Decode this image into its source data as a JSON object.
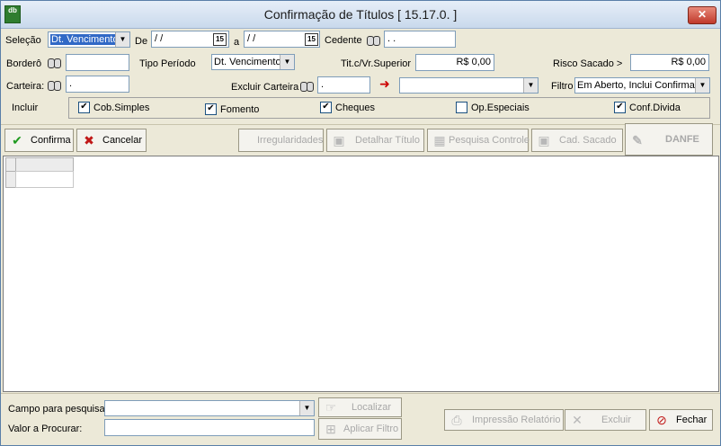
{
  "window": {
    "title": "Confirmação de Títulos [ 15.17.0. ]",
    "app_icon_text": "db",
    "close_glyph": "✕"
  },
  "filters": {
    "selecao_label": "Seleção",
    "selecao_value": "Dt. Vencimento",
    "de_label": "De",
    "de_value": " / /",
    "a_label": "a",
    "a_value": " / /",
    "calendar_glyph": "15",
    "cedente_label": "Cedente",
    "cedente_value": "  .  .",
    "bordero_label": "Borderô",
    "bordero_value": "",
    "tipo_periodo_label": "Tipo Período",
    "tipo_periodo_value": "Dt. Vencimento",
    "tit_vr_superior_label": "Tit.c/Vr.Superior",
    "tit_vr_superior_value": "R$ 0,00",
    "risco_sacado_label": "Risco Sacado >",
    "risco_sacado_value": "R$ 0,00",
    "carteira_label": "Carteira:",
    "carteira_value": "  .",
    "excluir_carteira_label": "Excluir Carteira",
    "excluir_carteira_value": "  .",
    "arrow_glyph": "➜",
    "excluir_combo_value": "",
    "filtro_label": "Filtro",
    "filtro_value": "Em Aberto, Inclui Confirmad"
  },
  "incluir": {
    "label": "Incluir",
    "options": [
      {
        "label": "Cob.Simples",
        "checked": true
      },
      {
        "label": "Fomento",
        "checked": true
      },
      {
        "label": "Cheques",
        "checked": true
      },
      {
        "label": "Op.Especiais",
        "checked": false
      },
      {
        "label": "Conf.Divida",
        "checked": true
      }
    ],
    "check_glyph": "✔"
  },
  "toolbar": {
    "confirma": "Confirma",
    "cancelar": "Cancelar",
    "irregularidades": "Irregularidades",
    "detalhar_titulo": "Detalhar Título",
    "pesquisa_controle": "Pesquisa Controle",
    "cad_sacado": "Cad. Sacado",
    "danfe": "DANFE",
    "confirma_icon": "✔",
    "cancelar_icon": "✖"
  },
  "search": {
    "campo_label": "Campo para pesquisa",
    "campo_value": "",
    "valor_label": "Valor a Procurar:",
    "valor_value": "",
    "localizar": "Localizar",
    "aplicar_filtro": "Aplicar Filtro"
  },
  "footer": {
    "impressao_relatorio": "Impressão Relatório",
    "excluir": "Excluir",
    "fechar": "Fechar"
  },
  "colors": {
    "selection": "#3169c6",
    "close_button": "#c0392b",
    "confirma_icon": "#1f9a1f",
    "cancelar_icon": "#c01818"
  }
}
